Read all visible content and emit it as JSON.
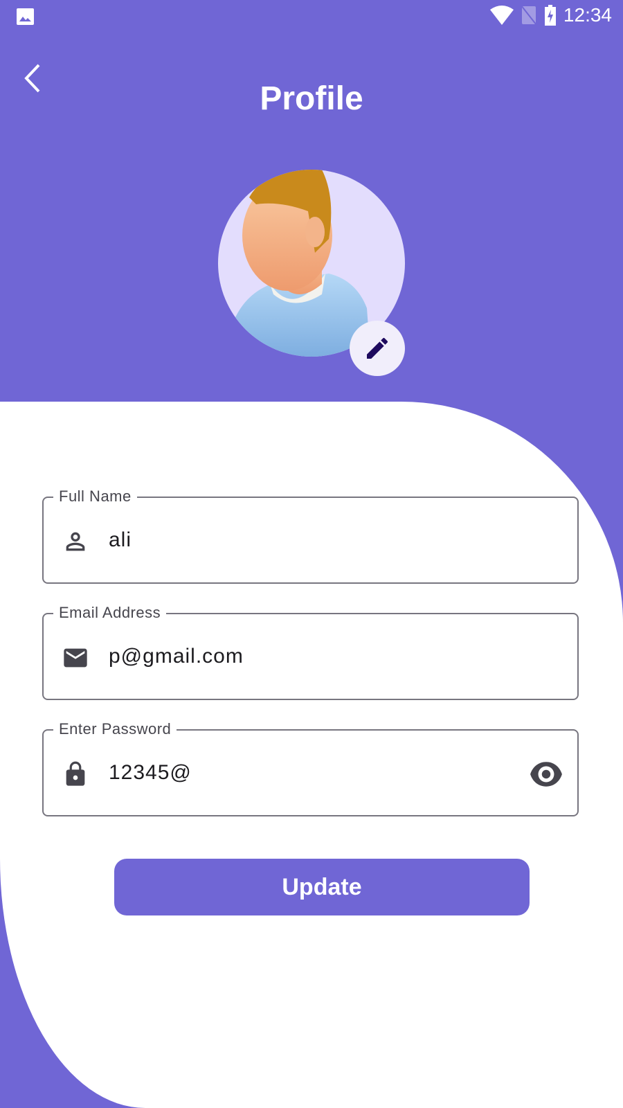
{
  "status_bar": {
    "time": "12:34"
  },
  "header": {
    "title": "Profile"
  },
  "form": {
    "full_name": {
      "label": "Full Name",
      "value": "ali"
    },
    "email": {
      "label": "Email Address",
      "value": "p@gmail.com"
    },
    "password": {
      "label": "Enter Password",
      "value": "12345@"
    }
  },
  "update_label": "Update",
  "colors": {
    "primary": "#7066d5",
    "avatar_bg": "#e3ddfd",
    "edit_icon": "#1e0a5e"
  }
}
